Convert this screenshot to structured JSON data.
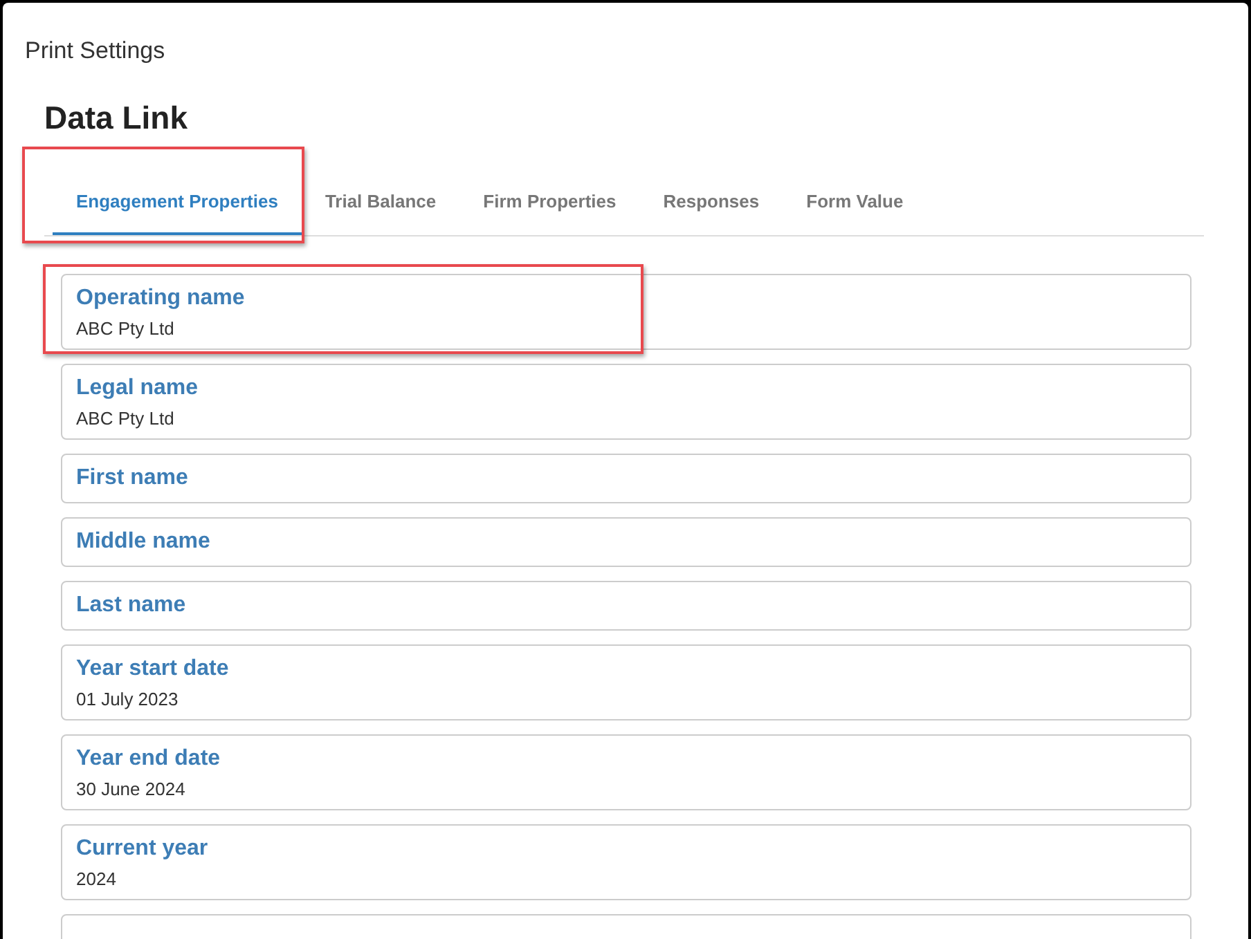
{
  "window": {
    "title": "Print Settings"
  },
  "heading": "Data Link",
  "tabs": [
    {
      "label": "Engagement Properties",
      "selected": true,
      "highlighted": true
    },
    {
      "label": "Trial Balance",
      "selected": false,
      "highlighted": false
    },
    {
      "label": "Firm Properties",
      "selected": false,
      "highlighted": false
    },
    {
      "label": "Responses",
      "selected": false,
      "highlighted": false
    },
    {
      "label": "Form Value",
      "selected": false,
      "highlighted": false
    }
  ],
  "fields": [
    {
      "label": "Operating name",
      "value": "ABC Pty Ltd",
      "highlighted": true
    },
    {
      "label": "Legal name",
      "value": "ABC Pty Ltd",
      "highlighted": false
    },
    {
      "label": "First name",
      "highlighted": false
    },
    {
      "label": "Middle name",
      "highlighted": false
    },
    {
      "label": "Last name",
      "highlighted": false
    },
    {
      "label": "Year start date",
      "value": "01 July 2023",
      "highlighted": false
    },
    {
      "label": "Year end date",
      "value": "30 June 2024",
      "highlighted": false
    },
    {
      "label": "Current year",
      "value": "2024",
      "highlighted": false
    },
    {
      "highlighted": false
    }
  ]
}
